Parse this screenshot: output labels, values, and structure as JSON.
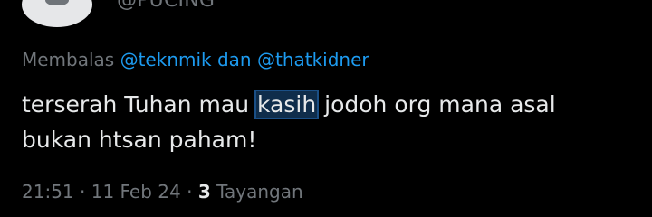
{
  "profile": {
    "handle": "@PUCING"
  },
  "reply": {
    "prefix": "Membalas",
    "mention_1": "@teknmik",
    "conjunction": "dan",
    "mention_2": "@thatkidner"
  },
  "tweet": {
    "line1_before": "terserah Tuhan mau",
    "highlight": "kasih",
    "line1_after": "jodoh org mana asal",
    "line2": "bukan htsan paham!"
  },
  "meta": {
    "time": "21:51",
    "date": "11 Feb 24",
    "views_count": "3",
    "views_label": "Tayangan"
  },
  "colors": {
    "background": "#000000",
    "text": "#e7e9ea",
    "muted": "#71767b",
    "link": "#1d9bf0",
    "highlight": "#0f2d4b"
  }
}
